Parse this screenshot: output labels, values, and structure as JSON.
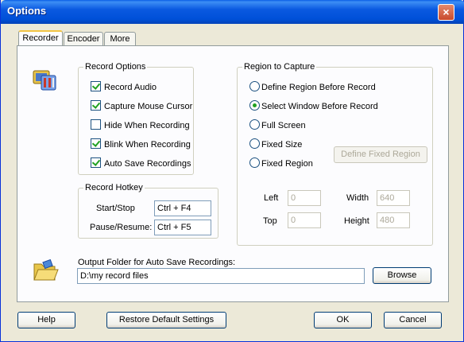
{
  "window": {
    "title": "Options",
    "close_label": "×"
  },
  "tabs": [
    {
      "label": "Recorder",
      "active": true
    },
    {
      "label": "Encoder",
      "active": false
    },
    {
      "label": "More",
      "active": false
    }
  ],
  "record_options": {
    "title": "Record Options",
    "items": [
      {
        "label": "Record Audio",
        "checked": true
      },
      {
        "label": "Capture Mouse Cursor",
        "checked": true
      },
      {
        "label": "Hide When Recording",
        "checked": false
      },
      {
        "label": "Blink When Recording",
        "checked": true
      },
      {
        "label": "Auto Save Recordings",
        "checked": true
      }
    ]
  },
  "record_hotkey": {
    "title": "Record Hotkey",
    "start_stop_label": "Start/Stop",
    "start_stop_value": "Ctrl + F4",
    "pause_resume_label": "Pause/Resume:",
    "pause_resume_value": "Ctrl + F5"
  },
  "region": {
    "title": "Region to Capture",
    "options": [
      {
        "label": "Define Region Before Record",
        "checked": false
      },
      {
        "label": "Select Window Before Record",
        "checked": true
      },
      {
        "label": "Full Screen",
        "checked": false
      },
      {
        "label": "Fixed Size",
        "checked": false
      },
      {
        "label": "Fixed Region",
        "checked": false
      }
    ],
    "define_fixed_region_label": "Define Fixed Region",
    "left_label": "Left",
    "left_value": "0",
    "top_label": "Top",
    "top_value": "0",
    "width_label": "Width",
    "width_value": "640",
    "height_label": "Height",
    "height_value": "480"
  },
  "output": {
    "label": "Output Folder for Auto Save Recordings:",
    "value": "D:\\my record files",
    "browse_label": "Browse"
  },
  "footer": {
    "help_label": "Help",
    "restore_label": "Restore Default Settings",
    "ok_label": "OK",
    "cancel_label": "Cancel"
  }
}
